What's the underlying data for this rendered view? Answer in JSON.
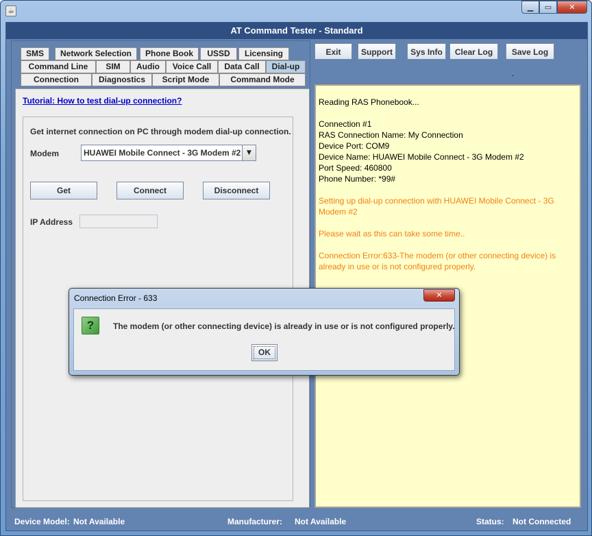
{
  "window": {
    "title": "AT Command Tester - Standard"
  },
  "tabs": [
    {
      "label": "SMS"
    },
    {
      "label": "Network Selection"
    },
    {
      "label": "Phone Book"
    },
    {
      "label": "USSD"
    },
    {
      "label": "Licensing"
    },
    {
      "label": "Command Line"
    },
    {
      "label": "SIM"
    },
    {
      "label": "Audio"
    },
    {
      "label": "Voice Call"
    },
    {
      "label": "Data Call"
    },
    {
      "label": "Dial-up"
    },
    {
      "label": "Connection"
    },
    {
      "label": "Diagnostics"
    },
    {
      "label": "Script Mode"
    },
    {
      "label": "Command Mode"
    }
  ],
  "dialup": {
    "tutorial_link": "Tutorial: How to test dial-up connection?",
    "description": "Get internet connection on PC through modem dial-up connection.",
    "modem_label": "Modem",
    "modem_value": "HUAWEI Mobile Connect - 3G Modem #2",
    "get_label": "Get",
    "connect_label": "Connect",
    "disconnect_label": "Disconnect",
    "ip_label": "IP Address",
    "ip_value": ""
  },
  "toolbar": {
    "exit": "Exit",
    "support": "Support",
    "sysinfo": "Sys Info",
    "clearlog": "Clear Log",
    "savelog": "Save Log",
    "dot": "."
  },
  "log": [
    {
      "text": "Reading RAS Phonebook...",
      "color": "black"
    },
    {
      "text": "",
      "color": "black"
    },
    {
      "text": "Connection #1",
      "color": "black"
    },
    {
      "text": "RAS Connection Name: My Connection",
      "color": "black"
    },
    {
      "text": "Device Port: COM9",
      "color": "black"
    },
    {
      "text": "Device Name: HUAWEI Mobile Connect - 3G Modem #2",
      "color": "black"
    },
    {
      "text": "Port Speed: 460800",
      "color": "black"
    },
    {
      "text": "Phone Number: *99#",
      "color": "black"
    },
    {
      "text": "",
      "color": "black"
    },
    {
      "text": "Setting up dial-up connection with HUAWEI Mobile Connect - 3G",
      "color": "orange"
    },
    {
      "text": "Modem #2",
      "color": "orange"
    },
    {
      "text": "",
      "color": "black"
    },
    {
      "text": "Please wait as this can take some time..",
      "color": "orange"
    },
    {
      "text": "",
      "color": "black"
    },
    {
      "text": "Connection Error:633-The modem (or other connecting device) is",
      "color": "orange"
    },
    {
      "text": "already in use or is not configured properly.",
      "color": "orange"
    }
  ],
  "status": {
    "device_model_label": "Device Model:",
    "device_model_value": "Not Available",
    "manufacturer_label": "Manufacturer:",
    "manufacturer_value": "Not Available",
    "status_label": "Status:",
    "status_value": "Not Connected"
  },
  "dialog": {
    "title": "Connection Error - 633",
    "close_glyph": "✕",
    "icon_glyph": "?",
    "message": "The modem (or other connecting device) is already in use or is not configured properly.",
    "ok_label": "OK"
  },
  "icons": {
    "app": "java-cup-icon",
    "minimize": "minimize-icon",
    "maximize": "maximize-icon",
    "close": "close-icon",
    "dropdown": "chevron-down-icon",
    "question": "question-icon"
  },
  "colors": {
    "title_bar": "#2f4f82",
    "panel": "#6383b0",
    "log_bg": "#ffffcc",
    "log_orange": "#f08010",
    "link": "#0000cc"
  }
}
